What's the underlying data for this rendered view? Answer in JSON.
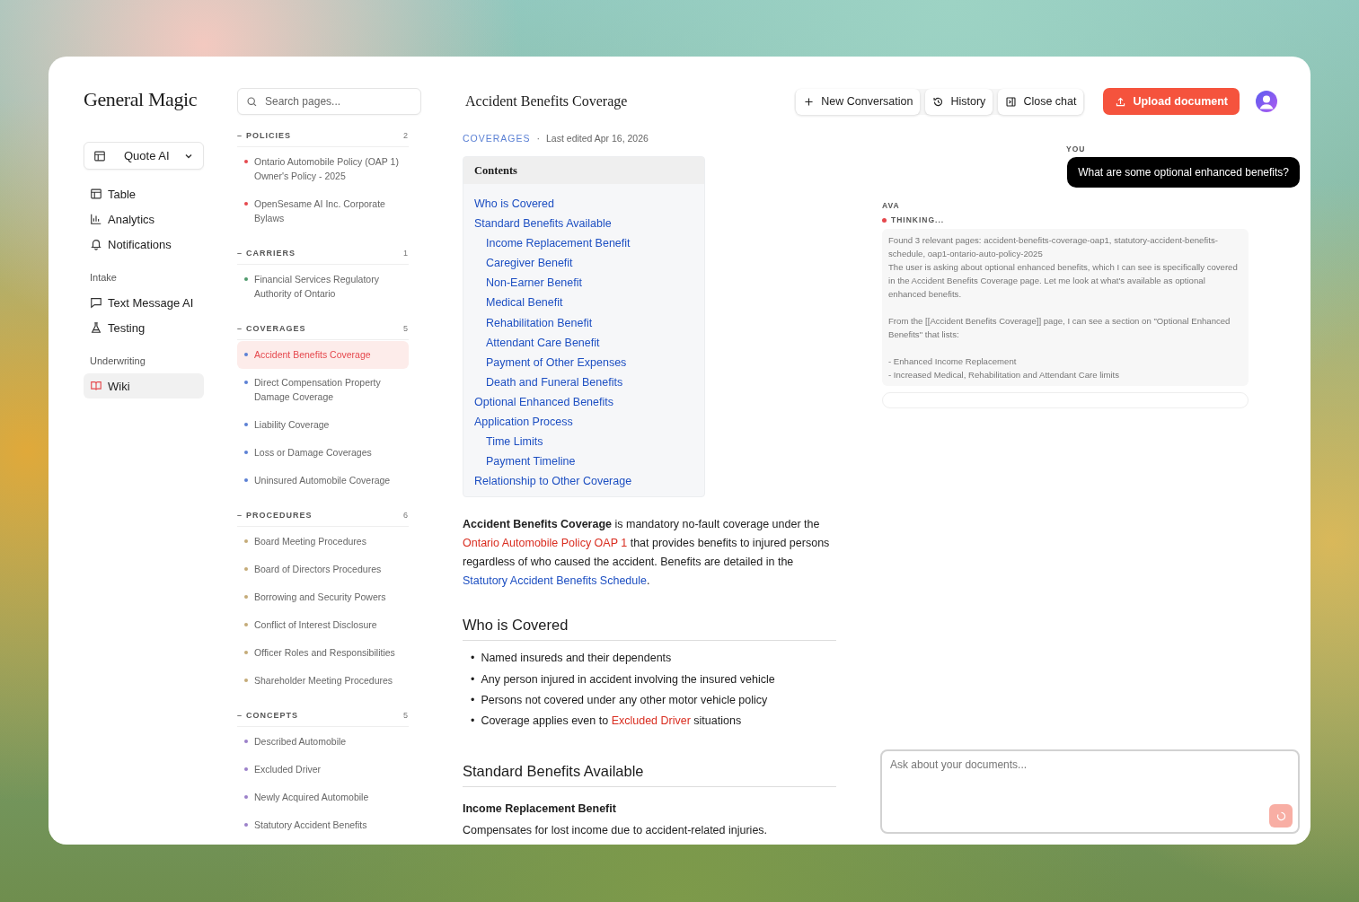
{
  "logo": "General Magic",
  "workspace": {
    "label": "Quote AI"
  },
  "nav": [
    {
      "items": [
        {
          "label": "Table",
          "kind": "table",
          "selected": false
        },
        {
          "label": "Analytics",
          "kind": "chart",
          "selected": false
        },
        {
          "label": "Notifications",
          "kind": "bell",
          "selected": false
        }
      ]
    },
    {
      "heading": "Intake",
      "items": [
        {
          "label": "Text Message AI",
          "kind": "message",
          "selected": false
        },
        {
          "label": "Testing",
          "kind": "flask",
          "selected": false
        }
      ]
    },
    {
      "heading": "Underwriting",
      "items": [
        {
          "label": "Wiki",
          "kind": "book",
          "selected": true
        }
      ]
    }
  ],
  "search": {
    "placeholder": "Search pages..."
  },
  "sections": [
    {
      "toggle": "–",
      "title": "POLICIES",
      "count": "2",
      "color": "#e5484d",
      "pages": [
        {
          "title": "Ontario Automobile Policy (OAP 1) Owner's Policy - 2025",
          "selected": false
        },
        {
          "title": "OpenSesame AI Inc. Corporate Bylaws",
          "selected": false
        }
      ]
    },
    {
      "toggle": "–",
      "title": "CARRIERS",
      "count": "1",
      "color": "#4f9a6c",
      "pages": [
        {
          "title": "Financial Services Regulatory Authority of Ontario",
          "selected": false
        }
      ]
    },
    {
      "toggle": "–",
      "title": "COVERAGES",
      "count": "5",
      "color": "#5b80d4",
      "pages": [
        {
          "title": "Accident Benefits Coverage",
          "selected": true
        },
        {
          "title": "Direct Compensation Property Damage Coverage",
          "selected": false
        },
        {
          "title": "Liability Coverage",
          "selected": false
        },
        {
          "title": "Loss or Damage Coverages",
          "selected": false
        },
        {
          "title": "Uninsured Automobile Coverage",
          "selected": false
        }
      ]
    },
    {
      "toggle": "–",
      "title": "PROCEDURES",
      "count": "6",
      "color": "#c4ab78",
      "pages": [
        {
          "title": "Board Meeting Procedures",
          "selected": false
        },
        {
          "title": "Board of Directors Procedures",
          "selected": false
        },
        {
          "title": "Borrowing and Security Powers",
          "selected": false
        },
        {
          "title": "Conflict of Interest Disclosure",
          "selected": false
        },
        {
          "title": "Officer Roles and Responsibilities",
          "selected": false
        },
        {
          "title": "Shareholder Meeting Procedures",
          "selected": false
        }
      ]
    },
    {
      "toggle": "–",
      "title": "CONCEPTS",
      "count": "5",
      "color": "#9b80c9",
      "pages": [
        {
          "title": "Described Automobile",
          "selected": false
        },
        {
          "title": "Excluded Driver",
          "selected": false
        },
        {
          "title": "Newly Acquired Automobile",
          "selected": false
        },
        {
          "title": "Statutory Accident Benefits",
          "selected": false
        }
      ]
    }
  ],
  "article": {
    "title": "Accident Benefits Coverage",
    "category": "COVERAGES",
    "separator": "·",
    "edited": "Last edited Apr 16, 2026",
    "contents": {
      "heading": "Contents",
      "items": [
        {
          "label": "Who is Covered"
        },
        {
          "label": "Standard Benefits Available",
          "children": [
            {
              "label": "Income Replacement Benefit"
            },
            {
              "label": "Caregiver Benefit"
            },
            {
              "label": "Non-Earner Benefit"
            },
            {
              "label": "Medical Benefit"
            },
            {
              "label": "Rehabilitation Benefit"
            },
            {
              "label": "Attendant Care Benefit"
            },
            {
              "label": "Payment of Other Expenses"
            },
            {
              "label": "Death and Funeral Benefits"
            }
          ]
        },
        {
          "label": "Optional Enhanced Benefits"
        },
        {
          "label": "Application Process",
          "children": [
            {
              "label": "Time Limits"
            },
            {
              "label": "Payment Timeline"
            }
          ]
        },
        {
          "label": "Relationship to Other Coverage"
        }
      ]
    },
    "intro": [
      {
        "kind": "text",
        "text": "**Accident Benefits Coverage** is mandatory no-fault coverage under the "
      },
      {
        "kind": "missing-link",
        "text": "Ontario Automobile Policy OAP 1"
      },
      {
        "kind": "text",
        "text": " that provides benefits to injured persons regardless of who caused the accident. Benefits are detailed in the "
      },
      {
        "kind": "link",
        "text": "Statutory Accident Benefits Schedule"
      },
      {
        "kind": "text",
        "text": "."
      }
    ],
    "sections": [
      {
        "heading": "Who is Covered",
        "bullet": "•",
        "bullets": [
          [
            {
              "kind": "text",
              "text": "Named insureds and their dependents"
            }
          ],
          [
            {
              "kind": "text",
              "text": "Any person injured in accident involving the insured vehicle"
            }
          ],
          [
            {
              "kind": "text",
              "text": "Persons not covered under any other motor vehicle policy"
            }
          ],
          [
            {
              "kind": "text",
              "text": "Coverage applies even to "
            },
            {
              "kind": "missing-link",
              "text": "Excluded Driver"
            },
            {
              "kind": "text",
              "text": " situations"
            }
          ]
        ]
      },
      {
        "heading": "Standard Benefits Available",
        "subsections": [
          {
            "heading": "Income Replacement Benefit",
            "text": "Compensates for lost income due to accident-related injuries."
          }
        ]
      }
    ]
  },
  "toolbar": {
    "buttons": [
      {
        "label": "New Conversation",
        "kind": "plus"
      },
      {
        "label": "History",
        "kind": "history"
      },
      {
        "label": "Close chat",
        "kind": "panel"
      }
    ],
    "upload": "Upload document"
  },
  "chat": {
    "user_label": "YOU",
    "user_message": "What are some optional enhanced benefits?",
    "assistant_label": "AVA",
    "status": "THINKING...",
    "thinking": [
      [
        "Found 3 relevant pages: accident-benefits-coverage-oap1, statutory-accident-benefits-schedule, oap1-ontario-auto-policy-2025",
        "The user is asking about optional enhanced benefits, which I can see is specifically covered in the Accident Benefits Coverage page. Let me look at what's available as optional enhanced benefits."
      ],
      [
        "From the [[Accident Benefits Coverage]] page, I can see a section on \"Optional Enhanced Benefits\" that lists:"
      ],
      [
        "- Enhanced Income Replacement",
        "- Increased Medical, Rehabilitation and Attendant Care limits"
      ]
    ],
    "composer": {
      "placeholder": "Ask about your documents..."
    }
  }
}
